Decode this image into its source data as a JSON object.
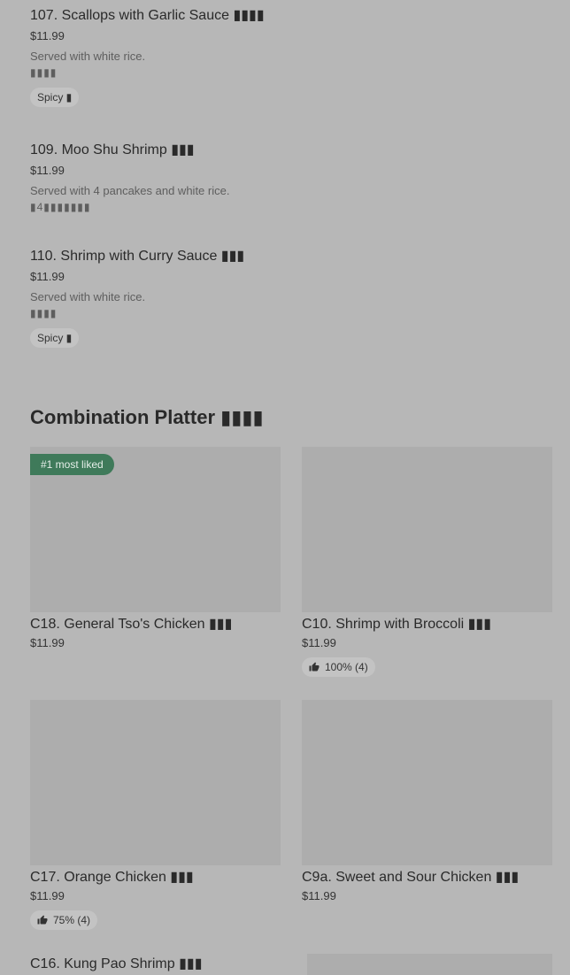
{
  "items": [
    {
      "title": "107. Scallops with Garlic Sauce ▮▮▮▮",
      "price": "$11.99",
      "desc": "Served with white rice.",
      "desc2": "▮▮▮▮",
      "tag": "Spicy ▮"
    },
    {
      "title": "109. Moo Shu Shrimp ▮▮▮",
      "price": "$11.99",
      "desc": "Served with 4 pancakes and white rice.",
      "desc2": "▮4▮▮▮▮▮▮▮"
    },
    {
      "title": "110. Shrimp with Curry Sauce ▮▮▮",
      "price": "$11.99",
      "desc": "Served with white rice.",
      "desc2": "▮▮▮▮",
      "tag": "Spicy ▮"
    }
  ],
  "section": {
    "title": "Combination Platter ▮▮▮▮"
  },
  "cards": [
    {
      "name": "C18. General Tso's Chicken ▮▮▮",
      "price": "$11.99",
      "badge": "#1 most liked"
    },
    {
      "name": "C10. Shrimp with Broccoli ▮▮▮",
      "price": "$11.99",
      "rating": "100% (4)"
    },
    {
      "name": "C17. Orange Chicken ▮▮▮",
      "price": "$11.99",
      "rating": "75% (4)"
    },
    {
      "name": "C9a. Sweet and Sour Chicken ▮▮▮",
      "price": "$11.99"
    },
    {
      "name": "C16. Kung Pao Shrimp ▮▮▮"
    }
  ],
  "icons": {
    "rating": "thumbs-up-icon"
  }
}
